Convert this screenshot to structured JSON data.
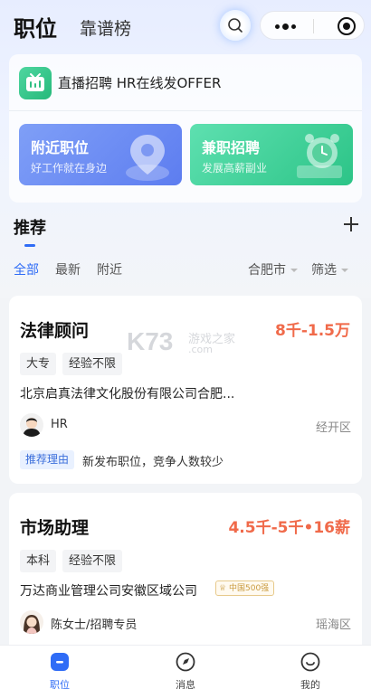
{
  "header": {
    "tab_active": "职位",
    "tab_other": "靠谱榜"
  },
  "live_banner": {
    "text": "直播招聘 HR在线发OFFER"
  },
  "features": [
    {
      "title": "附近职位",
      "subtitle": "好工作就在身边",
      "color": "#6f8ff5"
    },
    {
      "title": "兼职招聘",
      "subtitle": "发展高薪副业",
      "color": "#3fcf95"
    }
  ],
  "recommend": {
    "title": "推荐",
    "filters": [
      "全部",
      "最新",
      "附近"
    ],
    "city": "合肥市",
    "screen": "筛选"
  },
  "jobs": [
    {
      "title": "法律顾问",
      "salary": "8千-1.5万",
      "tags": [
        "大专",
        "经验不限"
      ],
      "company": "北京启真法律文化股份有限公司合肥...",
      "recruiter": "HR",
      "location": "经开区",
      "reason_label": "推荐理由",
      "reason_text": "新发布职位，竞争人数较少"
    },
    {
      "title": "市场助理",
      "salary": "4.5千-5千•16薪",
      "tags": [
        "本科",
        "经验不限"
      ],
      "company": "万达商业管理公司安徽区域公司",
      "badge": "中国500强",
      "recruiter": "陈女士/招聘专员",
      "location": "瑶海区"
    }
  ],
  "watermark": {
    "main": "K73",
    "line1": "游戏之家",
    "line2": ".com"
  },
  "bottom_nav": [
    {
      "label": "职位",
      "icon": "briefcase-icon",
      "active": true
    },
    {
      "label": "消息",
      "icon": "message-icon",
      "active": false
    },
    {
      "label": "我的",
      "icon": "profile-icon",
      "active": false
    }
  ],
  "colors": {
    "accent": "#2f6cf6",
    "salary": "#f06a4a"
  }
}
